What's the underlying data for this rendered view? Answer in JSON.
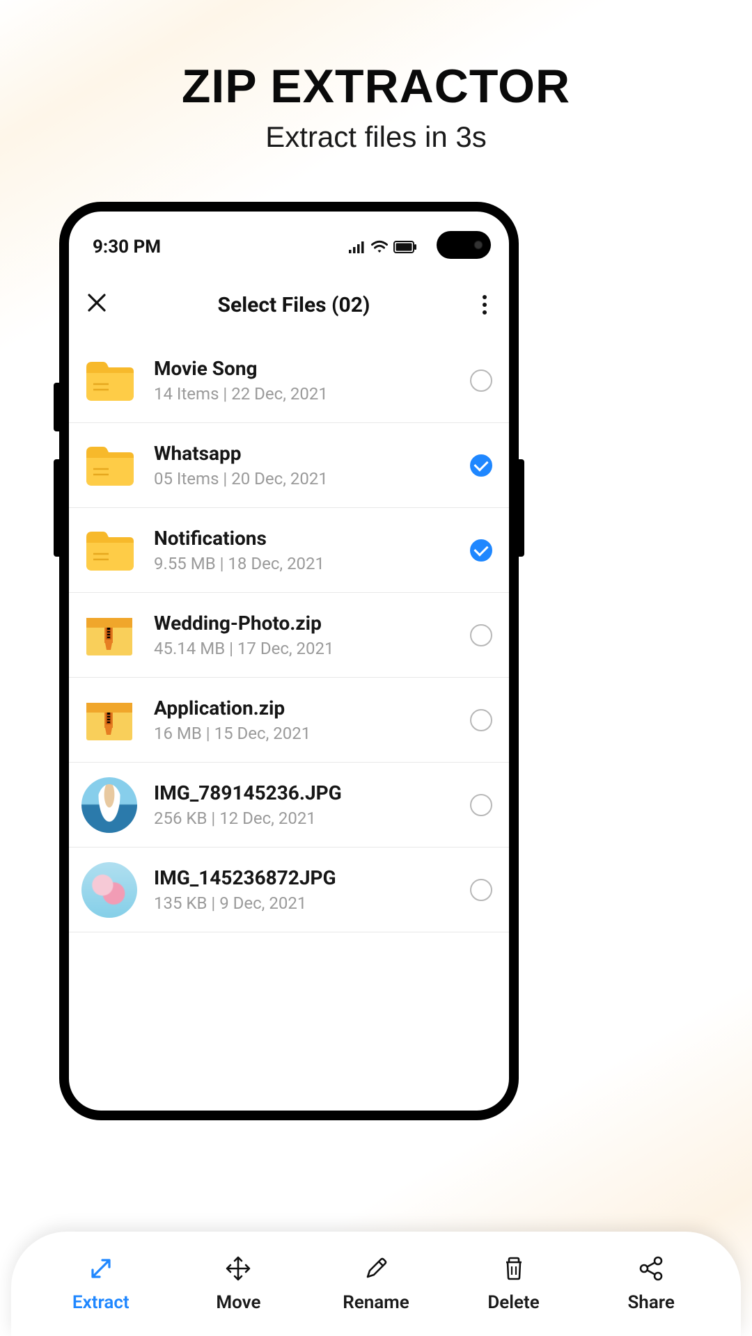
{
  "promo": {
    "title": "ZIP EXTRACTOR",
    "subtitle": "Extract files in 3s"
  },
  "statusbar": {
    "time": "9:30 PM"
  },
  "appbar": {
    "title": "Select Files (02)"
  },
  "files": [
    {
      "name": "Movie Song",
      "meta": "14 Items | 22 Dec, 2021",
      "type": "folder",
      "selected": false
    },
    {
      "name": "Whatsapp",
      "meta": "05 Items | 20 Dec, 2021",
      "type": "folder",
      "selected": true
    },
    {
      "name": "Notifications",
      "meta": "9.55 MB | 18 Dec, 2021",
      "type": "folder",
      "selected": true
    },
    {
      "name": "Wedding-Photo.zip",
      "meta": "45.14 MB | 17 Dec, 2021",
      "type": "zip",
      "selected": false
    },
    {
      "name": "Application.zip",
      "meta": "16 MB | 15 Dec, 2021",
      "type": "zip",
      "selected": false
    },
    {
      "name": "IMG_789145236.JPG",
      "meta": "256 KB | 12 Dec, 2021",
      "type": "image1",
      "selected": false
    },
    {
      "name": "IMG_145236872JPG",
      "meta": "135 KB | 9 Dec, 2021",
      "type": "image2",
      "selected": false
    }
  ],
  "actions": [
    {
      "id": "extract",
      "label": "Extract",
      "active": true
    },
    {
      "id": "move",
      "label": "Move",
      "active": false
    },
    {
      "id": "rename",
      "label": "Rename",
      "active": false
    },
    {
      "id": "delete",
      "label": "Delete",
      "active": false
    },
    {
      "id": "share",
      "label": "Share",
      "active": false
    }
  ]
}
